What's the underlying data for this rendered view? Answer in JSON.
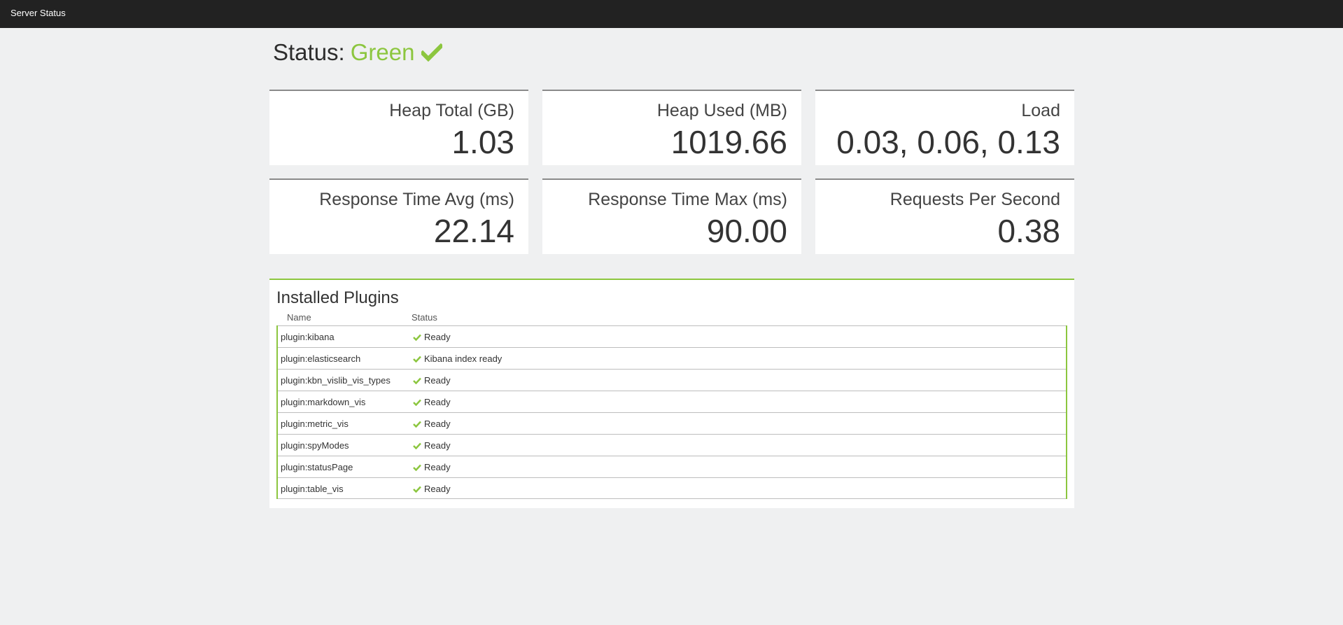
{
  "topbar": {
    "title": "Server Status"
  },
  "status": {
    "prefix": "Status:",
    "state": "Green",
    "color": "#8cc63f"
  },
  "metrics": [
    {
      "label": "Heap Total (GB)",
      "value": "1.03"
    },
    {
      "label": "Heap Used (MB)",
      "value": "1019.66"
    },
    {
      "label": "Load",
      "value": "0.03, 0.06, 0.13"
    },
    {
      "label": "Response Time Avg (ms)",
      "value": "22.14"
    },
    {
      "label": "Response Time Max (ms)",
      "value": "90.00"
    },
    {
      "label": "Requests Per Second",
      "value": "0.38"
    }
  ],
  "plugins": {
    "title": "Installed Plugins",
    "columns": {
      "name": "Name",
      "status": "Status"
    },
    "rows": [
      {
        "name": "plugin:kibana",
        "status": "Ready",
        "icon": "check-icon"
      },
      {
        "name": "plugin:elasticsearch",
        "status": "Kibana index ready",
        "icon": "check-icon"
      },
      {
        "name": "plugin:kbn_vislib_vis_types",
        "status": "Ready",
        "icon": "check-icon"
      },
      {
        "name": "plugin:markdown_vis",
        "status": "Ready",
        "icon": "check-icon"
      },
      {
        "name": "plugin:metric_vis",
        "status": "Ready",
        "icon": "check-icon"
      },
      {
        "name": "plugin:spyModes",
        "status": "Ready",
        "icon": "check-icon"
      },
      {
        "name": "plugin:statusPage",
        "status": "Ready",
        "icon": "check-icon"
      },
      {
        "name": "plugin:table_vis",
        "status": "Ready",
        "icon": "check-icon"
      }
    ]
  }
}
